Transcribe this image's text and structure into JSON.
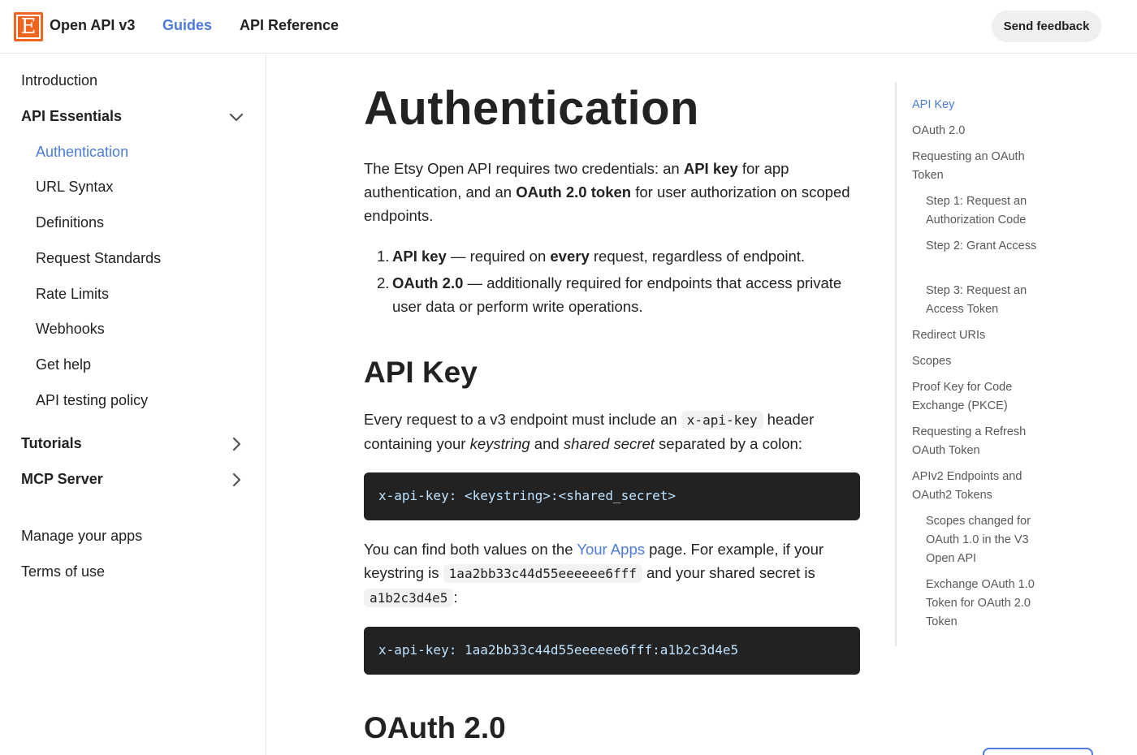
{
  "header": {
    "brand": "Open API v3",
    "nav": {
      "guides": "Guides",
      "reference": "API Reference"
    },
    "feedback": "Send feedback"
  },
  "sidebar": {
    "introduction": "Introduction",
    "api_essentials": "API Essentials",
    "essentials_items": [
      "Authentication",
      "URL Syntax",
      "Definitions",
      "Request Standards",
      "Rate Limits",
      "Webhooks",
      "Get help",
      "API testing policy"
    ],
    "tutorials": "Tutorials",
    "mcp_server": "MCP Server",
    "manage_apps": "Manage your apps",
    "terms": "Terms of use"
  },
  "content": {
    "title": "Authentication",
    "intro": {
      "t1": "The Etsy Open API requires two credentials: an ",
      "b1": "API key",
      "t2": " for app authentication, and an ",
      "b2": "OAuth 2.0 token",
      "t3": " for user authorization on scoped endpoints."
    },
    "list": [
      {
        "num": "1.",
        "b": "API key",
        "t1": " — required on ",
        "b2": "every",
        "t2": " request, regardless of endpoint."
      },
      {
        "num": "2.",
        "b": "OAuth 2.0",
        "t1": " — additionally required for endpoints that access private user data or perform write operations."
      }
    ],
    "apikey_heading": "API Key",
    "apikey_para": {
      "t1": "Every request to a v3 endpoint must include an ",
      "code": "x-api-key",
      "t2": " header containing your ",
      "i1": "keystring",
      "t3": " and ",
      "i2": "shared secret",
      "t4": " separated by a colon:"
    },
    "code1": "x-api-key: <keystring>:<shared_secret>",
    "find_para": {
      "t1": "You can find both values on the ",
      "link": "Your Apps",
      "t2": " page. For example, if your keystring is ",
      "code1": "1aa2bb33c44d55eeeeee6fff",
      "t3": " and your shared secret is ",
      "code2": "a1b2c3d4e5",
      "t4": ":"
    },
    "code2": "x-api-key: 1aa2bb33c44d55eeeeee6fff:a1b2c3d4e5",
    "oauth_heading": "OAuth 2.0"
  },
  "toc": [
    "API Key",
    "OAuth 2.0",
    "Requesting an OAuth Token",
    "Step 1: Request an Authorization Code",
    "Step 2: Grant Access",
    "Step 3: Request an Access Token",
    "Redirect URIs",
    "Scopes",
    "Proof Key for Code Exchange (PKCE)",
    "Requesting a Refresh OAuth Token",
    "APIv2 Endpoints and OAuth2 Tokens",
    "Scopes changed for OAuth 1.0 in the V3 Open API",
    "Exchange OAuth 1.0 Token for OAuth 2.0 Token"
  ],
  "icons": {
    "logo": "etsy-logo-icon",
    "expanded": "chevron-down-icon",
    "collapsed": "chevron-right-icon"
  },
  "colors": {
    "accent": "#4c7bd9",
    "brand": "#f1641e",
    "code_bg": "#222222",
    "code_text": "#bfe3ff"
  }
}
